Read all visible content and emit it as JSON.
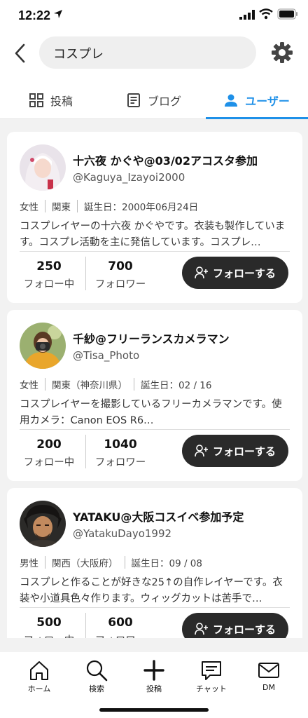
{
  "status": {
    "time": "12:22"
  },
  "search": {
    "query": "コスプレ"
  },
  "tabs": [
    {
      "label": "投稿",
      "icon": "grid-icon"
    },
    {
      "label": "ブログ",
      "icon": "document-icon"
    },
    {
      "label": "ユーザー",
      "icon": "person-icon",
      "active": true
    }
  ],
  "colors": {
    "accent": "#1e90e8",
    "button": "#2a2a2a"
  },
  "users": [
    {
      "name": "十六夜 かぐや@03/02アコスタ参加",
      "handle": "@Kaguya_Izayoi2000",
      "gender": "女性",
      "region": "関東",
      "birthday": "誕生日：2000年06月24日",
      "bio": "コスプレイヤーの十六夜 かぐやです。衣装も製作しています。コスプレ活動を主に発信しています。コスプレ…",
      "following": "250",
      "following_label": "フォロー中",
      "followers": "700",
      "followers_label": "フォロワー",
      "follow_label": "フォローする"
    },
    {
      "name": "千紗@フリーランスカメラマン",
      "handle": "@Tisa_Photo",
      "gender": "女性",
      "region": "関東（神奈川県）",
      "birthday": "誕生日：02 / 16",
      "bio": "コスプレイヤーを撮影しているフリーカメラマンです。使用カメラ：Canon EOS R6…",
      "following": "200",
      "following_label": "フォロー中",
      "followers": "1040",
      "followers_label": "フォロワー",
      "follow_label": "フォローする"
    },
    {
      "name": "YATAKU@大阪コスイベ参加予定",
      "handle": "@YatakuDayo1992",
      "gender": "男性",
      "region": "関西（大阪府）",
      "birthday": "誕生日：09 / 08",
      "bio": "コスプレと作ることが好きな25↑の自作レイヤーです。衣装や小道具色々作ります。ウィッグカットは苦手で…",
      "following": "500",
      "following_label": "フォロー中",
      "followers": "600",
      "followers_label": "フォロワー",
      "follow_label": "フォローする"
    }
  ],
  "bottom_nav": [
    {
      "label": "ホーム",
      "icon": "home-icon"
    },
    {
      "label": "検索",
      "icon": "search-icon"
    },
    {
      "label": "投稿",
      "icon": "plus-icon"
    },
    {
      "label": "チャット",
      "icon": "chat-icon"
    },
    {
      "label": "DM",
      "icon": "mail-icon"
    }
  ]
}
